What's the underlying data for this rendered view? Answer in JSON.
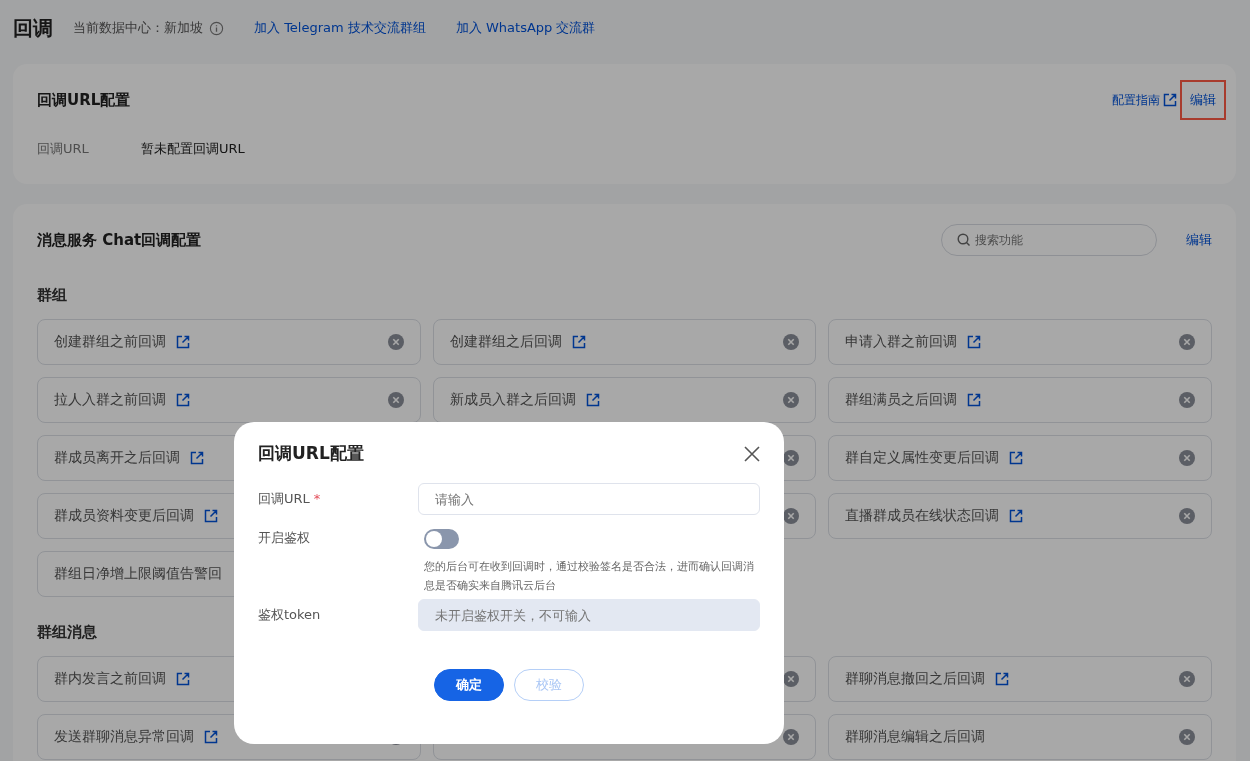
{
  "header": {
    "title": "回调",
    "datacenter": "当前数据中心：新加坡",
    "links": [
      "加入 Telegram 技术交流群组",
      "加入 WhatsApp 交流群"
    ]
  },
  "url_card": {
    "title": "回调URL配置",
    "guide_link": "配置指南",
    "edit_link": {
      "label": "编辑",
      "highlighted": true
    },
    "field_label": "回调URL",
    "field_value": "暂未配置回调URL"
  },
  "chat_card": {
    "title": "消息服务 Chat回调配置",
    "search": {
      "placeholder": "搜索功能"
    },
    "edit_link": "编辑",
    "sections": [
      {
        "title": "群组",
        "items": [
          {
            "label": "创建群组之前回调",
            "link": true,
            "clear": true
          },
          {
            "label": "创建群组之后回调",
            "link": true,
            "clear": true
          },
          {
            "label": "申请入群之前回调",
            "link": true,
            "clear": true
          },
          {
            "label": "拉人入群之前回调",
            "link": true,
            "clear": true
          },
          {
            "label": "新成员入群之后回调",
            "link": true,
            "clear": true
          },
          {
            "label": "群组满员之后回调",
            "link": true,
            "clear": true
          },
          {
            "label": "群成员离开之后回调",
            "link": true
          },
          {
            "link": false,
            "clear": true
          },
          {
            "label": "群自定义属性变更后回调",
            "link": true,
            "clear": true
          },
          {
            "label": "群成员资料变更后回调",
            "link": true
          },
          {
            "link": false,
            "clear": true
          },
          {
            "label": "直播群成员在线状态回调",
            "link": true,
            "clear": true
          },
          {
            "label": "群组日净增上限阈值告警回",
            "link": false
          }
        ]
      },
      {
        "title": "群组消息",
        "items": [
          {
            "label": "群内发言之前回调",
            "link": true
          },
          {
            "link": false,
            "clear": true
          },
          {
            "label": "群聊消息撤回之后回调",
            "link": true,
            "clear": true
          },
          {
            "label": "发送群聊消息异常回调",
            "link": true,
            "clear": true
          },
          {
            "link": false,
            "clear": true
          },
          {
            "label": "群聊消息编辑之后回调",
            "link": false,
            "clear": true
          }
        ]
      }
    ]
  },
  "dialog": {
    "title": "回调URL配置",
    "url_label": "回调URL",
    "url_required": "*",
    "url_placeholder": "请输入",
    "auth_label": "开启鉴权",
    "auth_on": false,
    "auth_hint": "您的后台可在收到回调时，通过校验签名是否合法，进而确认回调消息是否确实来自腾讯云后台",
    "token_label": "鉴权token",
    "token_placeholder": "未开启鉴权开关，不可输入",
    "token_disabled": true,
    "buttons": [
      {
        "label": "确定",
        "kind": "primary"
      },
      {
        "label": "校验",
        "kind": "disabled"
      }
    ]
  }
}
